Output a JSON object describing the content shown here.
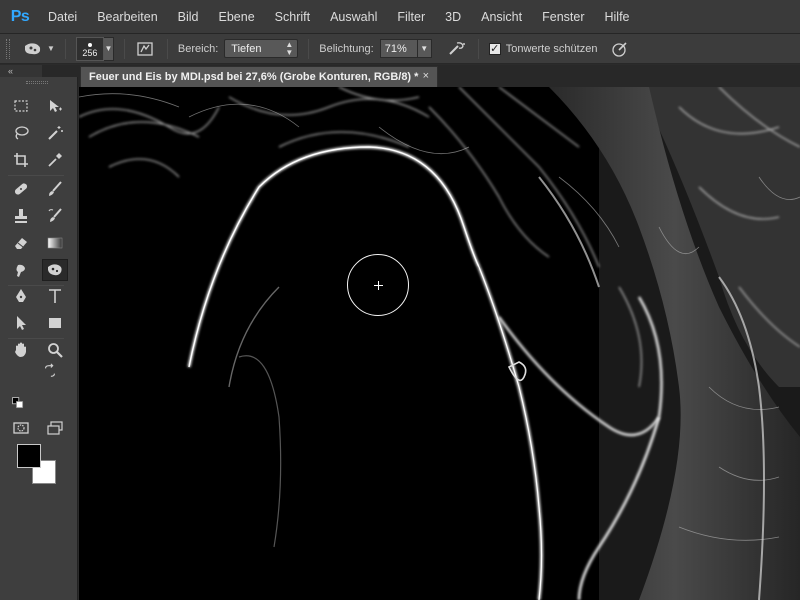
{
  "app": {
    "logo": "Ps",
    "accent_color": "#31a8ff"
  },
  "menu": {
    "items": [
      "Datei",
      "Bearbeiten",
      "Bild",
      "Ebene",
      "Schrift",
      "Auswahl",
      "Filter",
      "3D",
      "Ansicht",
      "Fenster",
      "Hilfe"
    ]
  },
  "options": {
    "tool_icon": "sponge-tool-icon",
    "brush_size": "256",
    "range_label": "Bereich:",
    "range_value": "Tiefen",
    "exposure_label": "Belichtung:",
    "exposure_value": "71%",
    "protect_tones_label": "Tonwerte schützen",
    "protect_tones_checked": true
  },
  "document": {
    "tab_title": "Feuer und Eis by MDI.psd bei 27,6% (Grobe Konturen, RGB/8) *",
    "close_glyph": "×"
  },
  "toolbox": {
    "collapse_glyph": "«",
    "foreground_color": "#000000",
    "background_color": "#ffffff"
  }
}
